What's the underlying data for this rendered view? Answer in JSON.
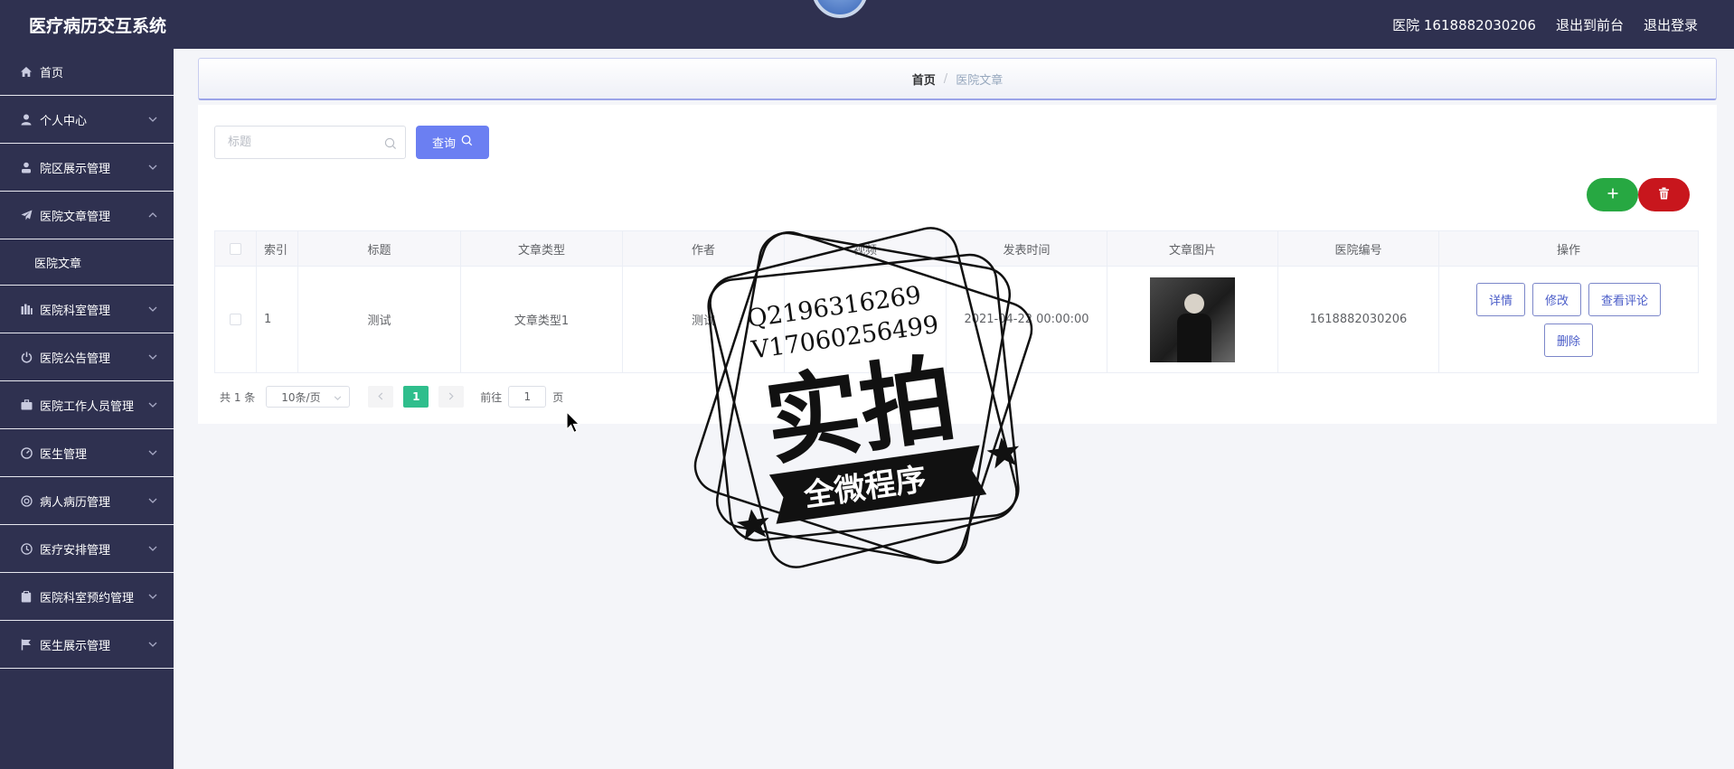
{
  "header": {
    "app_title": "医疗病历交互系统",
    "user_label": "医院 1618882030206",
    "front_link": "退出到前台",
    "logout_link": "退出登录"
  },
  "sidebar": {
    "items": [
      {
        "label": "首页",
        "icon": "home-icon"
      },
      {
        "label": "个人中心",
        "icon": "user-icon"
      },
      {
        "label": "院区展示管理",
        "icon": "person-icon"
      },
      {
        "label": "医院文章管理",
        "icon": "send-icon"
      },
      {
        "label": "医院科室管理",
        "icon": "bars-icon"
      },
      {
        "label": "医院公告管理",
        "icon": "power-icon"
      },
      {
        "label": "医院工作人员管理",
        "icon": "briefcase-icon"
      },
      {
        "label": "医生管理",
        "icon": "gauge-icon"
      },
      {
        "label": "病人病历管理",
        "icon": "settings-icon"
      },
      {
        "label": "医疗安排管理",
        "icon": "clock-icon"
      },
      {
        "label": "医院科室预约管理",
        "icon": "clipboard-icon"
      },
      {
        "label": "医生展示管理",
        "icon": "flag-icon"
      }
    ],
    "sub_item": "医院文章"
  },
  "breadcrumb": {
    "home": "首页",
    "separator": "/",
    "current": "医院文章"
  },
  "search": {
    "placeholder": "标题",
    "query_label": "查询"
  },
  "table": {
    "headers": [
      "索引",
      "标题",
      "文章类型",
      "作者",
      "视频",
      "发表时间",
      "文章图片",
      "医院编号",
      "操作"
    ],
    "row": {
      "index": "1",
      "title": "测试",
      "type": "文章类型1",
      "author": "测试",
      "video": "",
      "published": "2021-04-22 00:00:00",
      "hospital_no": "1618882030206"
    },
    "actions": [
      "详情",
      "修改",
      "查看评论",
      "删除"
    ]
  },
  "pagination": {
    "total": "共 1 条",
    "page_size": "10条/页",
    "current_page": "1",
    "goto_label": "前往",
    "goto_value": "1",
    "page_unit": "页"
  },
  "watermark": {
    "contact_lines": [
      "Q2196316269",
      "V17060256499"
    ],
    "main_text": "实拍",
    "banner_text": "全微程序"
  },
  "colors": {
    "sidebar_bg": "#2f3150",
    "query_button": "#6b7ff2",
    "add_button": "#27a842",
    "delete_button": "#c8161d",
    "active_page": "#2fbe8c"
  }
}
